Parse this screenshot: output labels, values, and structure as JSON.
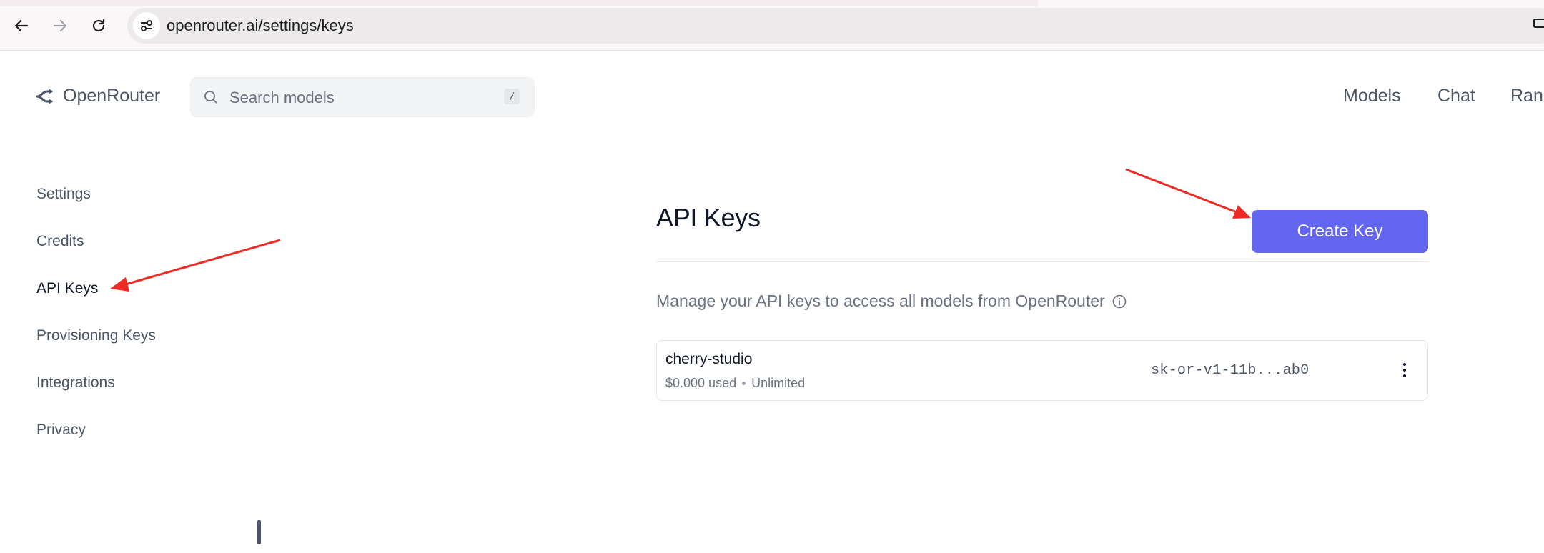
{
  "browser": {
    "url": "openrouter.ai/settings/keys"
  },
  "header": {
    "brand": "OpenRouter",
    "search_placeholder": "Search models",
    "search_shortcut": "/",
    "nav": [
      "Models",
      "Chat",
      "Rank"
    ]
  },
  "sidebar": {
    "items": [
      {
        "label": "Settings",
        "active": false
      },
      {
        "label": "Credits",
        "active": false
      },
      {
        "label": "API Keys",
        "active": true
      },
      {
        "label": "Provisioning Keys",
        "active": false
      },
      {
        "label": "Integrations",
        "active": false
      },
      {
        "label": "Privacy",
        "active": false
      }
    ]
  },
  "main": {
    "title": "API Keys",
    "create_button": "Create Key",
    "subtitle": "Manage your API keys to access all models from OpenRouter",
    "keys": [
      {
        "name": "cherry-studio",
        "usage": "$0.000 used",
        "limit": "Unlimited",
        "masked_key": "sk-or-v1-11b...ab0"
      }
    ]
  },
  "colors": {
    "accent": "#6366f1",
    "annotation_arrow": "#ee2a24"
  },
  "icons": [
    "back-arrow-icon",
    "forward-arrow-icon",
    "reload-icon",
    "site-settings-icon",
    "openrouter-logo-icon",
    "search-icon",
    "info-icon",
    "more-vertical-icon"
  ]
}
